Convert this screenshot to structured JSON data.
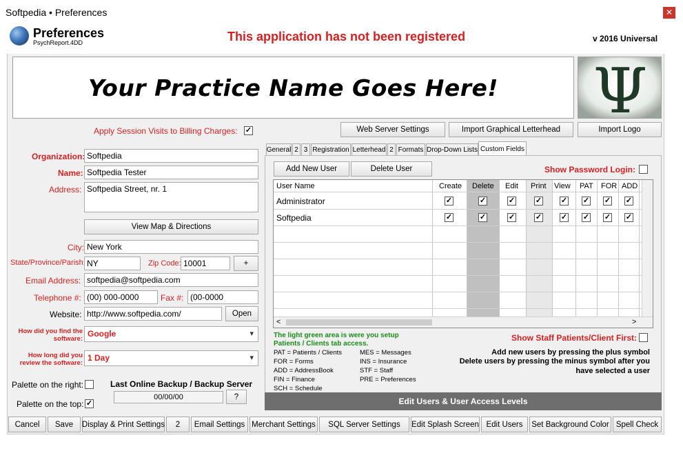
{
  "window": {
    "title": "Softpedia  • Preferences",
    "close_label": "✕"
  },
  "header": {
    "title": "Preferences",
    "subtitle": "PsychReport.4DD",
    "registration_warning": "This application has not been registered",
    "version": "v 2016 Universal"
  },
  "banner": {
    "practice_name": "Your Practice Name Goes Here!",
    "logo_glyph": "Ψ"
  },
  "top_buttons": {
    "web_server": "Web Server Settings",
    "import_letterhead": "Import Graphical Letterhead",
    "import_logo": "Import Logo"
  },
  "form": {
    "apply_session_label": "Apply Session Visits to Billing Charges:",
    "apply_session_checked": "✓",
    "organization_label": "Organization:",
    "organization_value": "Softpedia",
    "name_label": "Name:",
    "name_value": "Softpedia Tester",
    "address_label": "Address:",
    "address_value": "Softpedia Street, nr. 1",
    "view_map_button": "View Map & Directions",
    "city_label": "City:",
    "city_value": "New York",
    "state_label": "State/Province/Parish:",
    "state_value": "NY",
    "zip_label": "Zip Code:",
    "zip_value": "10001",
    "plus_button": "+",
    "email_label": "Email Address:",
    "email_value": "softpedia@softpedia.com",
    "telephone_label": "Telephone #:",
    "telephone_value": "(00) 000-0000",
    "fax_label": "Fax #:",
    "fax_value": "(00-0000",
    "website_label": "Website:",
    "website_value": "http://www.softpedia.com/",
    "open_button": "Open",
    "found_label_1": "How did you find the",
    "found_label_2": "software:",
    "found_value": "Google",
    "review_label_1": "How long did you",
    "review_label_2": "review the software:",
    "review_value": "1 Day",
    "palette_right_label": "Palette on the right:",
    "palette_top_label": "Palette on the top:",
    "palette_top_checked": "✓",
    "backup_label": "Last Online Backup / Backup Server",
    "backup_value": "00/00/00",
    "backup_help_button": "?"
  },
  "tabs": [
    {
      "label": "General"
    },
    {
      "label": "2"
    },
    {
      "label": "3"
    },
    {
      "label": "Registration"
    },
    {
      "label": "Letterhead"
    },
    {
      "label": "2"
    },
    {
      "label": "Formats"
    },
    {
      "label": "Drop-Down Lists"
    },
    {
      "label": "Custom Fields"
    }
  ],
  "users_panel": {
    "add_user_button": "Add New User",
    "delete_user_button": "Delete User",
    "show_password_label": "Show Password Login:",
    "columns": [
      "User Name",
      "Create",
      "Delete",
      "Edit",
      "Print",
      "View",
      "PAT",
      "FOR",
      "ADD"
    ],
    "rows": [
      {
        "name": "Administrator",
        "check": "✓"
      },
      {
        "name": "Softpedia",
        "check": "✓"
      }
    ],
    "scroll_left": "<",
    "scroll_right": ">",
    "green_note_1": "The light green area is were you setup",
    "green_note_2": "Patients / Clients tab access.",
    "show_staff_label": "Show Staff Patients/Client First:",
    "legend_left": [
      "PAT = Patients / Clients",
      "FOR = Forms",
      "ADD = AddressBook",
      "FIN = Finance",
      "SCH = Schedule"
    ],
    "legend_right": [
      "MES = Messages",
      "INS = Insurance",
      "STF = Staff",
      "PRE = Preferences"
    ],
    "help_1": "Add new users by pressing the plus symbol",
    "help_2": "Delete users by pressing the minus symbol after you",
    "help_3": "have selected a user",
    "edit_bar": "Edit Users & User Access Levels"
  },
  "bottom_buttons": [
    "Cancel",
    "Save",
    "Display & Print Settings",
    "2",
    "Email Settings",
    "Merchant Settings",
    "SQL Server Settings",
    "Edit Splash Screen",
    "Edit Users",
    "Set Background Color",
    "Spell Check"
  ]
}
